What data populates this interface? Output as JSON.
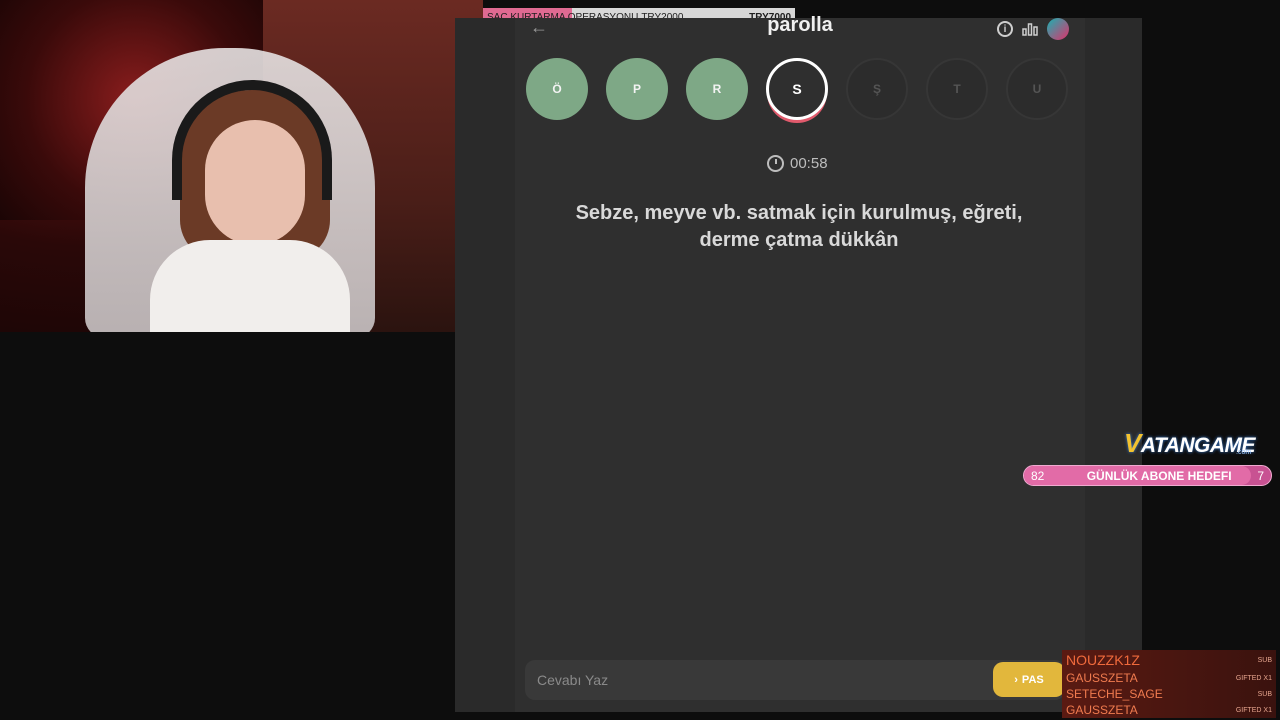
{
  "donation": {
    "title": "SAÇ KURTARMA OPERASYONU",
    "current": "TRY2000",
    "goal": "TRY7000",
    "progress": 0.286
  },
  "game": {
    "title": "parolla",
    "letters": [
      {
        "char": "Ö",
        "state": "done"
      },
      {
        "char": "P",
        "state": "done"
      },
      {
        "char": "R",
        "state": "done"
      },
      {
        "char": "S",
        "state": "current"
      },
      {
        "char": "Ş",
        "state": "pending"
      },
      {
        "char": "T",
        "state": "pending"
      },
      {
        "char": "U",
        "state": "pending"
      }
    ],
    "timer": "00:58",
    "question": "Sebze, meyve vb. satmak için kurulmuş, eğreti, derme çatma dükkân",
    "answer_placeholder": "Cevabı Yaz",
    "pass_label": "PAS"
  },
  "brand": {
    "name": "ATANGAME",
    "initial": "V",
    "suffix": ".com"
  },
  "sub_goal": {
    "current": "82",
    "label": "GÜNLÜK ABONE HEDEFI",
    "remaining": "7"
  },
  "events": [
    {
      "name": "NOUZZK1Z",
      "tag": "SUB"
    },
    {
      "name": "GAUSSZETA",
      "tag": "GIFTED X1"
    },
    {
      "name": "SETECHE_SAGE",
      "tag": "SUB"
    },
    {
      "name": "GAUSSZETA",
      "tag": "GIFTED X1"
    }
  ],
  "colors": {
    "done_letter": "#7ea886",
    "current_ring": "#ffffff",
    "pass_button": "#e2b73c",
    "sub_goal_bar": "#c85292"
  }
}
